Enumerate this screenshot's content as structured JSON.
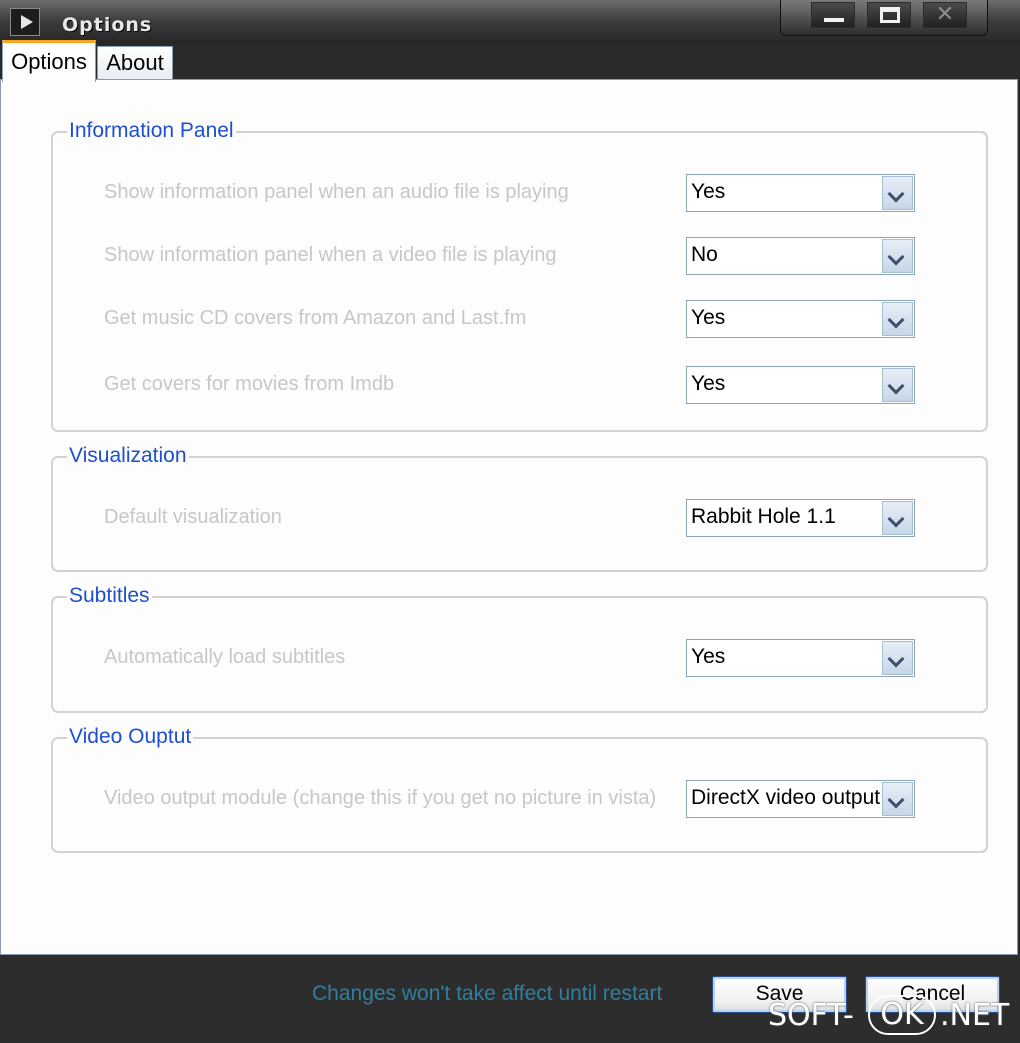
{
  "window": {
    "title": "Options",
    "controls": {
      "minimize": "minimize",
      "maximize": "maximize",
      "close": "✕"
    }
  },
  "tabs": [
    {
      "label": "Options",
      "active": true
    },
    {
      "label": "About",
      "active": false
    }
  ],
  "groups": {
    "information_panel": {
      "title": "Information Panel",
      "rows": [
        {
          "label": "Show information panel when an audio file is playing",
          "value": "Yes"
        },
        {
          "label": "Show information panel when a video file is playing",
          "value": "No"
        },
        {
          "label": "Get music CD covers from Amazon and Last.fm",
          "value": "Yes"
        },
        {
          "label": "Get covers for movies from Imdb",
          "value": "Yes"
        }
      ]
    },
    "visualization": {
      "title": "Visualization",
      "rows": [
        {
          "label": "Default visualization",
          "value": "Rabbit Hole 1.1"
        }
      ]
    },
    "subtitles": {
      "title": "Subtitles",
      "rows": [
        {
          "label": "Automatically load subtitles",
          "value": "Yes"
        }
      ]
    },
    "video_output": {
      "title": "Video Ouptut",
      "rows": [
        {
          "label": "Video output module (change this if you get no picture in vista)",
          "value": "DirectX video output"
        }
      ]
    }
  },
  "footer": {
    "status": "Changes won't take affect until restart",
    "save_label": "Save",
    "cancel_label": "Cancel"
  },
  "watermark": {
    "part1": "SOFT-",
    "part2": "OK",
    "part3": ".NET"
  },
  "colors": {
    "accent_tab": "#f5a623",
    "group_title": "#1e4fd0",
    "disabled_label": "#c7c7c7",
    "status_text": "#2f7f9e"
  }
}
